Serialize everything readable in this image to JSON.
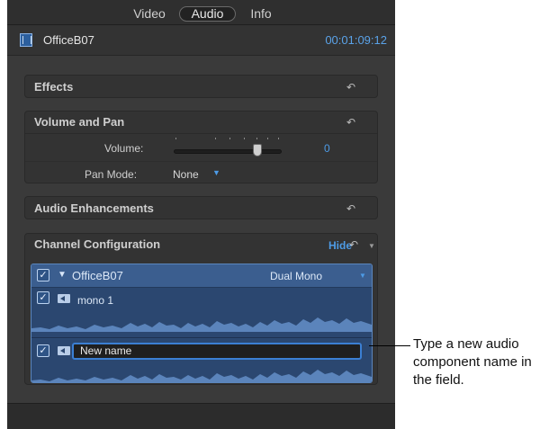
{
  "tabs": [
    {
      "label": "Video",
      "active": false
    },
    {
      "label": "Audio",
      "active": true
    },
    {
      "label": "Info",
      "active": false
    }
  ],
  "clip": {
    "name": "OfficeB07",
    "timecode": "00:01:09:12"
  },
  "sections": {
    "effects": {
      "title": "Effects"
    },
    "volume_pan": {
      "title": "Volume and Pan",
      "volume_label": "Volume:",
      "volume_value": "0",
      "pan_mode_label": "Pan Mode:",
      "pan_mode_value": "None"
    },
    "enhancements": {
      "title": "Audio Enhancements"
    },
    "channel": {
      "title": "Channel Configuration",
      "hide_label": "Hide",
      "parent": {
        "name": "OfficeB07",
        "mode": "Dual Mono",
        "checked": true
      },
      "components": [
        {
          "name": "mono 1",
          "checked": true
        },
        {
          "name": "New name",
          "checked": true,
          "editing": true
        }
      ]
    }
  },
  "callout": {
    "text": "Type a new audio component name in the field."
  },
  "colors": {
    "accent": "#4d9be6",
    "panel": "#3a3a3a",
    "channel_bg": "#2d4a74",
    "field_focus": "#3b7fd3"
  }
}
